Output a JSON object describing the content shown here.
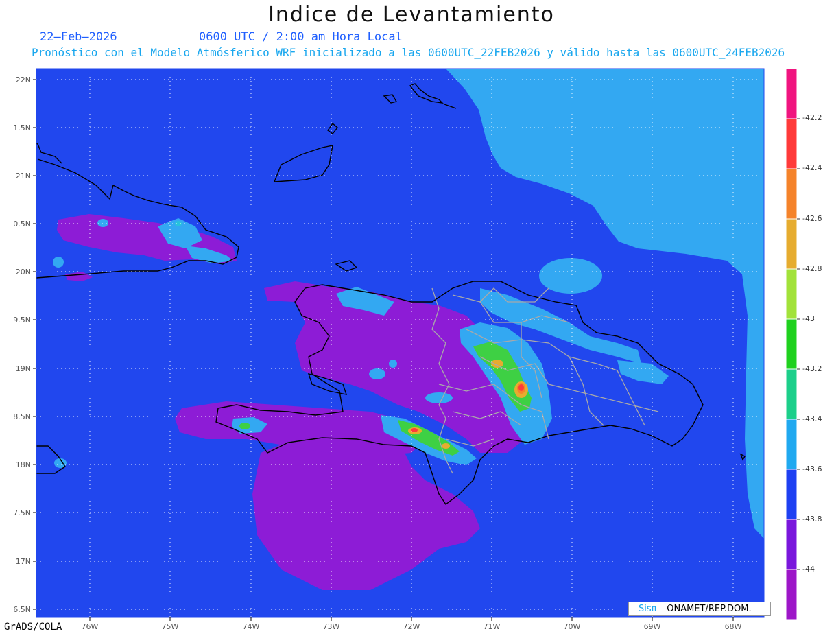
{
  "title": "Indice de Levantamiento",
  "date": "22–Feb–2026",
  "time": "0600 UTC / 2:00 am Hora Local",
  "description": "Pronóstico con el Modelo Atmósferico WRF inicializado a las 0600UTC_22FEB2026 y válido hasta las  0600UTC_24FEB2026",
  "footer_left": "GrADS/COLA",
  "credit": {
    "brand": "Sisπ",
    "org": " – ONAMET/REP.DOM."
  },
  "lat_labels": [
    "22N",
    "1.5N",
    "21N",
    "0.5N",
    "20N",
    "9.5N",
    "19N",
    "8.5N",
    "18N",
    "7.5N",
    "17N",
    "6.5N"
  ],
  "lon_labels": [
    "76W",
    "75W",
    "74W",
    "73W",
    "72W",
    "71W",
    "70W",
    "69W",
    "68W"
  ],
  "colorbar": {
    "labels": [
      "-42.2",
      "-42.4",
      "-42.6",
      "-42.8",
      "-43",
      "-43.2",
      "-43.4",
      "-43.6",
      "-43.8",
      "-44"
    ],
    "colors": [
      "#f0147f",
      "#ff3a3a",
      "#f5832a",
      "#e6ac2f",
      "#a2e23a",
      "#1fd11e",
      "#1ccf8a",
      "#20a9f0",
      "#1e40f2",
      "#7a17dc",
      "#9d16c8"
    ]
  },
  "colors": {
    "ocean": "#2147ee",
    "light_blue": "#33a8f2",
    "purple": "#8d1cd6",
    "cyan": "#27c2dc",
    "green": "#3ed044",
    "coast": "#000000",
    "borders": "#a9a9a9"
  }
}
